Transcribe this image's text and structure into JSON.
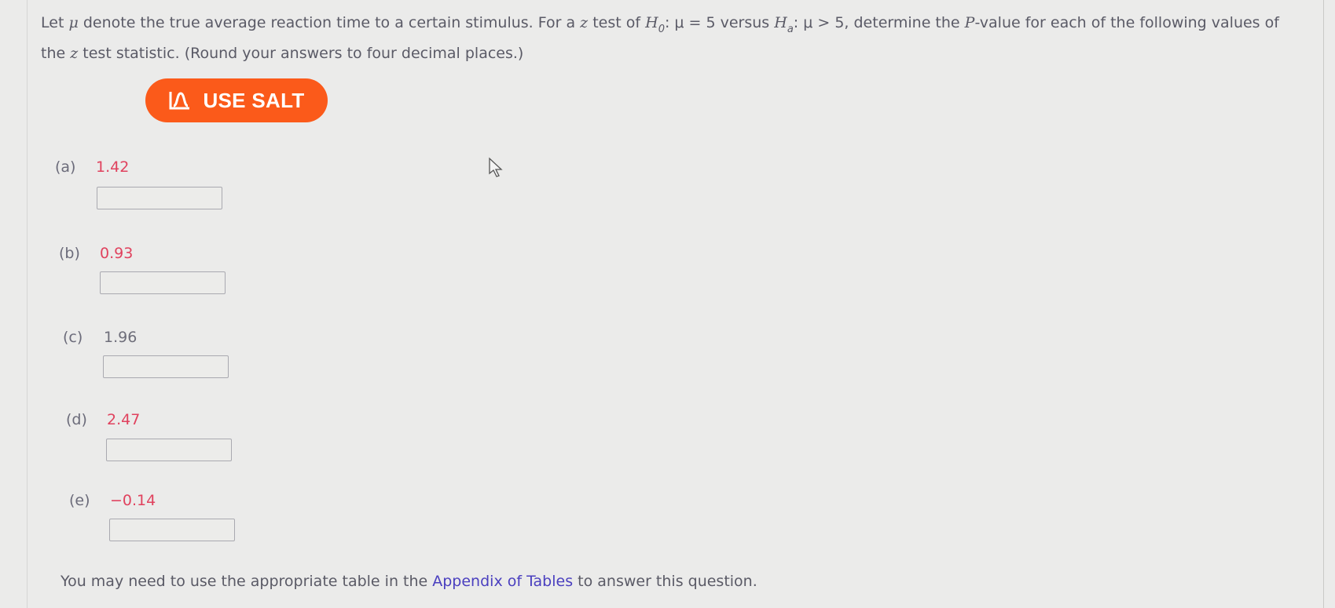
{
  "question": {
    "intro": "Let ",
    "mu": "μ",
    "text1": " denote the true average reaction time to a certain stimulus. For a ",
    "z": "z",
    "text2": " test of ",
    "H": "H",
    "sub0": "0",
    "null_hyp": ": μ = 5 versus ",
    "suba": "a",
    "alt_hyp": ": μ > 5, determine the ",
    "P": "P",
    "text3": "-value for each of the following values of the ",
    "text4": " test statistic. (Round your answers to four decimal places.)"
  },
  "salt_button": {
    "label": "USE SALT",
    "icon": "normal-curve-icon",
    "color": "#fb5a1a"
  },
  "parts": [
    {
      "label": "(a)",
      "value": "1.42",
      "answer": ""
    },
    {
      "label": "(b)",
      "value": "0.93",
      "answer": ""
    },
    {
      "label": "(c)",
      "value": "1.96",
      "answer": ""
    },
    {
      "label": "(d)",
      "value": "2.47",
      "answer": ""
    },
    {
      "label": "(e)",
      "value": "−0.14",
      "answer": ""
    }
  ],
  "footer": {
    "before": "You may need to use the appropriate table in the ",
    "link": "Appendix of Tables",
    "after": " to answer this question."
  }
}
